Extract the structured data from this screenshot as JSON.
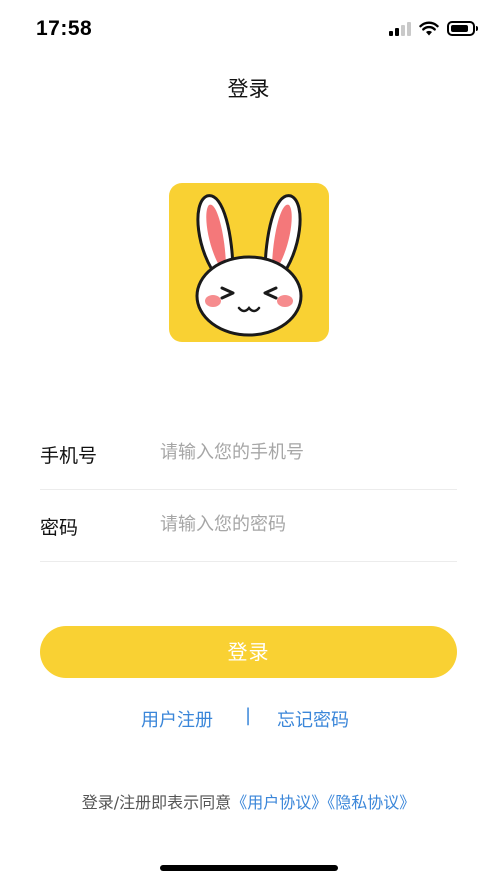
{
  "status_bar": {
    "time": "17:58",
    "signal_icon": "cellular-signal-icon",
    "signal_bars": 2,
    "wifi_icon": "wifi-icon",
    "battery_icon": "battery-icon",
    "battery_level": 0.85
  },
  "nav": {
    "title": "登录"
  },
  "logo": {
    "icon": "rabbit-logo-icon",
    "background_color": "#f9d133"
  },
  "form": {
    "phone": {
      "label": "手机号",
      "placeholder": "请输入您的手机号",
      "value": ""
    },
    "password": {
      "label": "密码",
      "placeholder": "请输入您的密码",
      "value": ""
    }
  },
  "login_button": {
    "label": "登录",
    "color": "#f9d133"
  },
  "links": {
    "register": "用户注册",
    "separator": "|",
    "forgot_password": "忘记密码",
    "color": "#3a86d9"
  },
  "agreement": {
    "prefix": "登录/注册即表示同意",
    "user_agreement": "《用户协议》",
    "privacy_policy": "《隐私协议》"
  }
}
